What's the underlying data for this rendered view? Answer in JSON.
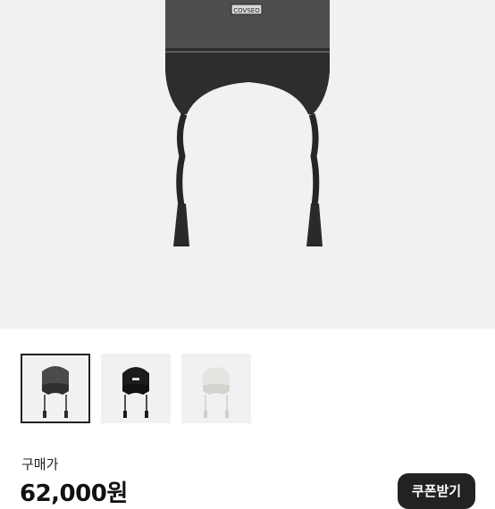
{
  "product": {
    "hat_label": "COVSEO",
    "image_alt": "earflap beanie, charcoal",
    "thumbnails": [
      {
        "name": "charcoal",
        "color": "#4a4a4a",
        "selected": true
      },
      {
        "name": "black",
        "color": "#1c1c1c",
        "selected": false
      },
      {
        "name": "ivory",
        "color": "#e4e4e0",
        "selected": false
      }
    ]
  },
  "price": {
    "label": "구매가",
    "value": "62,000원"
  },
  "coupon_button": {
    "label": "쿠폰받기"
  },
  "colors": {
    "background": "#f1f1f1",
    "button": "#222222"
  }
}
